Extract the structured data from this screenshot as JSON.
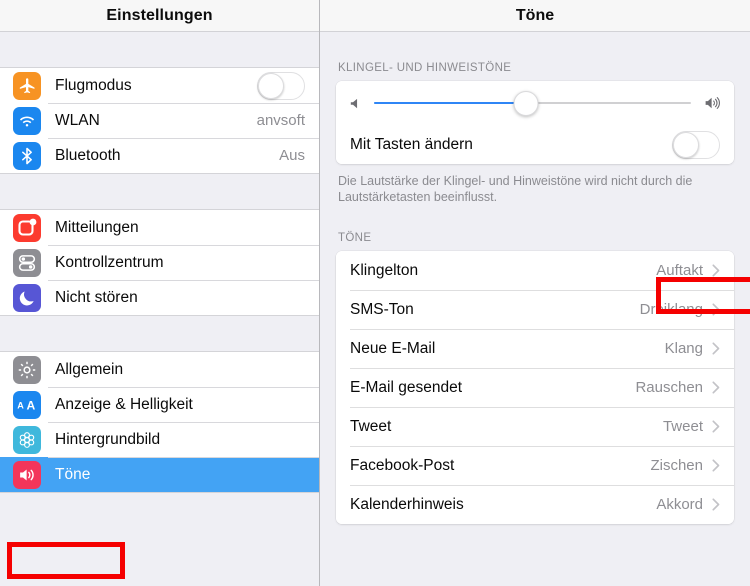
{
  "sidebar": {
    "title": "Einstellungen",
    "groups": [
      {
        "items": [
          {
            "label": "Flugmodus",
            "value": "",
            "control": "toggle",
            "icon": "airplane-icon",
            "icon_bg": "#f79323"
          },
          {
            "label": "WLAN",
            "value": "anvsoft",
            "control": "value",
            "icon": "wifi-icon",
            "icon_bg": "#1b87ef"
          },
          {
            "label": "Bluetooth",
            "value": "Aus",
            "control": "value",
            "icon": "bluetooth-icon",
            "icon_bg": "#1b87ef"
          }
        ]
      },
      {
        "items": [
          {
            "label": "Mitteilungen",
            "value": "",
            "control": "none",
            "icon": "notifications-icon",
            "icon_bg": "#fc3b2f"
          },
          {
            "label": "Kontrollzentrum",
            "value": "",
            "control": "none",
            "icon": "control-center-icon",
            "icon_bg": "#8e8e93"
          },
          {
            "label": "Nicht stören",
            "value": "",
            "control": "none",
            "icon": "moon-icon",
            "icon_bg": "#5756d5"
          }
        ]
      },
      {
        "items": [
          {
            "label": "Allgemein",
            "value": "",
            "control": "none",
            "icon": "gear-icon",
            "icon_bg": "#8e8e93"
          },
          {
            "label": "Anzeige & Helligkeit",
            "value": "",
            "control": "none",
            "icon": "display-aa-icon",
            "icon_bg": "#1b87ef"
          },
          {
            "label": "Hintergrundbild",
            "value": "",
            "control": "none",
            "icon": "wallpaper-flower-icon",
            "icon_bg": "#3fb8dc"
          },
          {
            "label": "Töne",
            "value": "",
            "control": "none",
            "icon": "sound-speaker-icon",
            "icon_bg": "#f3355b",
            "selected": true
          }
        ]
      }
    ]
  },
  "detail": {
    "title": "Töne",
    "ringer_section": {
      "header": "KLINGEL- UND HINWEISTÖNE",
      "slider": {
        "value_percent": 48,
        "min_icon": "speaker-low-icon",
        "max_icon": "speaker-high-icon",
        "fill_color": "#2f86f6"
      },
      "change_with_buttons": {
        "label": "Mit Tasten ändern",
        "state": "off"
      },
      "footnote": "Die Lautstärke der Klingel- und Hinweistöne wird nicht durch die Lautstärketasten beeinflusst."
    },
    "tones_section": {
      "header": "TÖNE",
      "rows": [
        {
          "label": "Klingelton",
          "value": "Auftakt",
          "highlighted": true
        },
        {
          "label": "SMS-Ton",
          "value": "Dreiklang"
        },
        {
          "label": "Neue E-Mail",
          "value": "Klang"
        },
        {
          "label": "E-Mail gesendet",
          "value": "Rauschen"
        },
        {
          "label": "Tweet",
          "value": "Tweet"
        },
        {
          "label": "Facebook-Post",
          "value": "Zischen"
        },
        {
          "label": "Kalenderhinweis",
          "value": "Akkord"
        }
      ]
    }
  },
  "annotations": {
    "color": "#f50000",
    "boxes": [
      "sidebar-item-toene",
      "detail-row-klingelton"
    ]
  }
}
